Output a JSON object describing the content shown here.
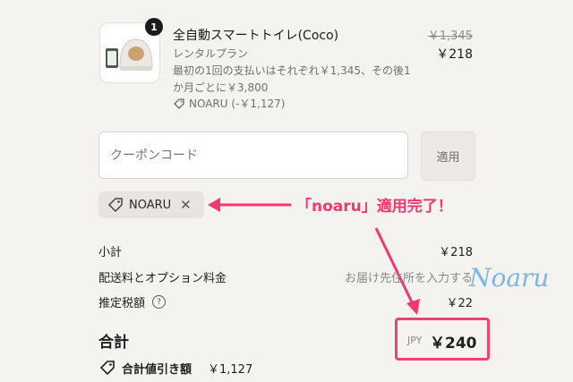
{
  "product": {
    "quantity": "1",
    "title": "全自動スマートトイレ(Coco)",
    "plan": "レンタルプラン",
    "description_line1": "最初の1回の支払いはそれぞれ￥1,345、その後1",
    "description_line2": "か月ごとに￥3,800",
    "discount_code": "NOARU (-￥1,127)",
    "original_price": "￥1,345",
    "price": "￥218"
  },
  "coupon": {
    "placeholder": "クーポンコード",
    "apply_label": "適用",
    "applied_code": "NOARU"
  },
  "annotation": {
    "note": "「noaru」適用完了！",
    "signature": "Noaru"
  },
  "summary": {
    "subtotal_label": "小計",
    "subtotal_value": "￥218",
    "shipping_label": "配送料とオプション料金",
    "shipping_hint": "お届け先住所を入力する",
    "tax_label": "推定税額",
    "tax_value": "￥22",
    "total_label": "合計",
    "currency": "JPY",
    "total_value": "￥240",
    "discount_label": "合計値引き額",
    "discount_value": "￥1,127"
  },
  "colors": {
    "accent": "#f2416f",
    "background": "#f5f3f0"
  }
}
